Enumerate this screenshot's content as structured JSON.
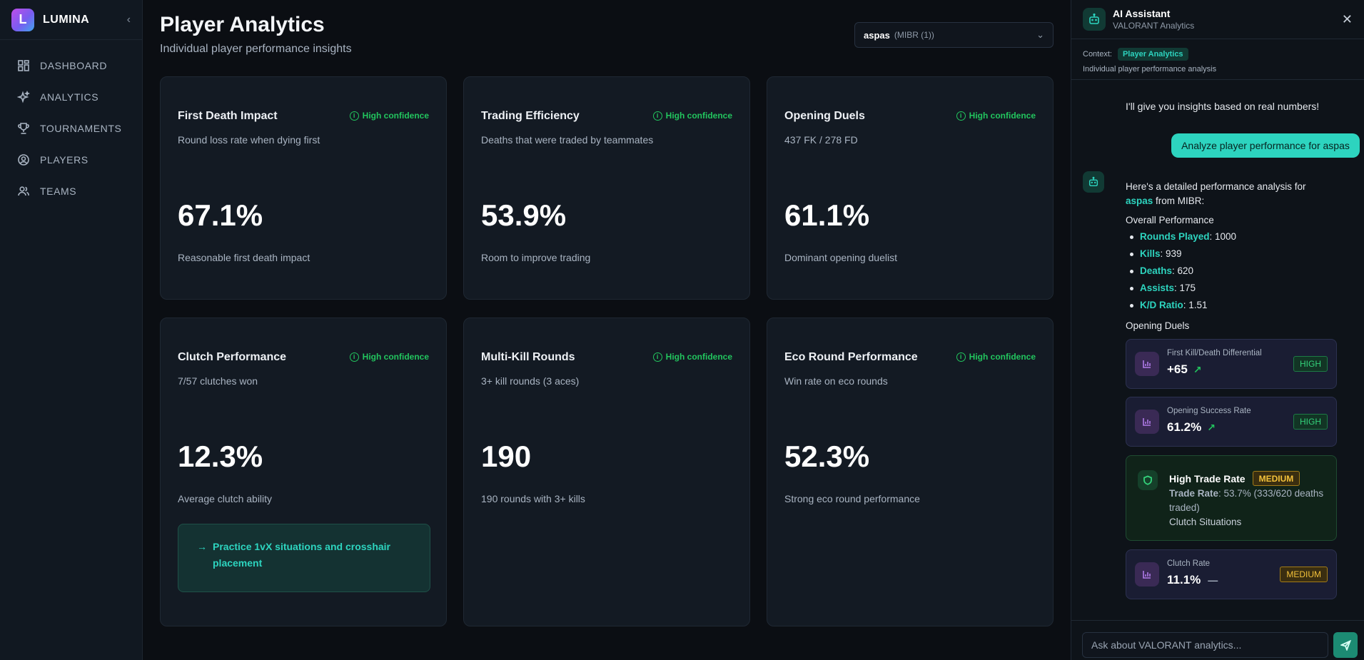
{
  "sidebar": {
    "logo_letter": "L",
    "brand": "LUMINA",
    "items": [
      {
        "label": "DASHBOARD",
        "icon": "grid-icon"
      },
      {
        "label": "ANALYTICS",
        "icon": "sparkles-icon"
      },
      {
        "label": "TOURNAMENTS",
        "icon": "trophy-icon"
      },
      {
        "label": "PLAYERS",
        "icon": "user-circle-icon"
      },
      {
        "label": "TEAMS",
        "icon": "users-icon"
      }
    ]
  },
  "header": {
    "title": "Player Analytics",
    "subtitle": "Individual player performance insights",
    "player_name": "aspas",
    "player_team": "(MIBR (1))"
  },
  "cards": [
    {
      "title": "First Death Impact",
      "confidence": "High confidence",
      "subtitle": "Round loss rate when dying first",
      "value": "67.1%",
      "note": "Reasonable first death impact"
    },
    {
      "title": "Trading Efficiency",
      "confidence": "High confidence",
      "subtitle": "Deaths that were traded by teammates",
      "value": "53.9%",
      "note": "Room to improve trading"
    },
    {
      "title": "Opening Duels",
      "confidence": "High confidence",
      "subtitle": "437 FK / 278 FD",
      "value": "61.1%",
      "note": "Dominant opening duelist"
    },
    {
      "title": "Clutch Performance",
      "confidence": "High confidence",
      "subtitle": "7/57 clutches won",
      "value": "12.3%",
      "note": "Average clutch ability",
      "tip": "Practice 1vX situations and crosshair placement"
    },
    {
      "title": "Multi-Kill Rounds",
      "confidence": "High confidence",
      "subtitle": "3+ kill rounds (3 aces)",
      "value": "190",
      "note": "190 rounds with 3+ kills"
    },
    {
      "title": "Eco Round Performance",
      "confidence": "High confidence",
      "subtitle": "Win rate on eco rounds",
      "value": "52.3%",
      "note": "Strong eco round performance"
    }
  ],
  "assistant": {
    "title": "AI Assistant",
    "subtitle": "VALORANT Analytics",
    "context_label": "Context:",
    "context_pill": "Player Analytics",
    "context_desc": "Individual player performance analysis",
    "intro": "I'll give you insights based on real numbers!",
    "user_message": "Analyze player performance for aspas",
    "reply_line1": "Here's a detailed performance analysis for",
    "reply_player": "aspas",
    "reply_line2": " from MIBR:",
    "overall_heading": "Overall Performance",
    "stats": [
      {
        "label": "Rounds Played",
        "value": ": 1000"
      },
      {
        "label": "Kills",
        "value": ": 939"
      },
      {
        "label": "Deaths",
        "value": ": 620"
      },
      {
        "label": "Assists",
        "value": ": 175"
      },
      {
        "label": "K/D Ratio",
        "value": ": 1.51"
      }
    ],
    "opening_heading": "Opening Duels",
    "metrics": [
      {
        "label": "First Kill/Death Differential",
        "value": "+65",
        "badge": "HIGH"
      },
      {
        "label": "Opening Success Rate",
        "value": "61.2%",
        "badge": "HIGH"
      },
      {
        "label": "Clutch Rate",
        "value": "11.1%",
        "badge": "MEDIUM"
      }
    ],
    "trade": {
      "title": "High Trade Rate",
      "badge": "MEDIUM",
      "label": "Trade Rate",
      "detail": ": 53.7% (333/620 deaths traded)",
      "extra": "Clutch Situations"
    },
    "input_placeholder": "Ask about VALORANT analytics..."
  },
  "colors": {
    "accent": "#2dd4bf",
    "confidence_green": "#22c55e",
    "badge_high": "#34d27b",
    "badge_medium": "#f3c13a"
  }
}
